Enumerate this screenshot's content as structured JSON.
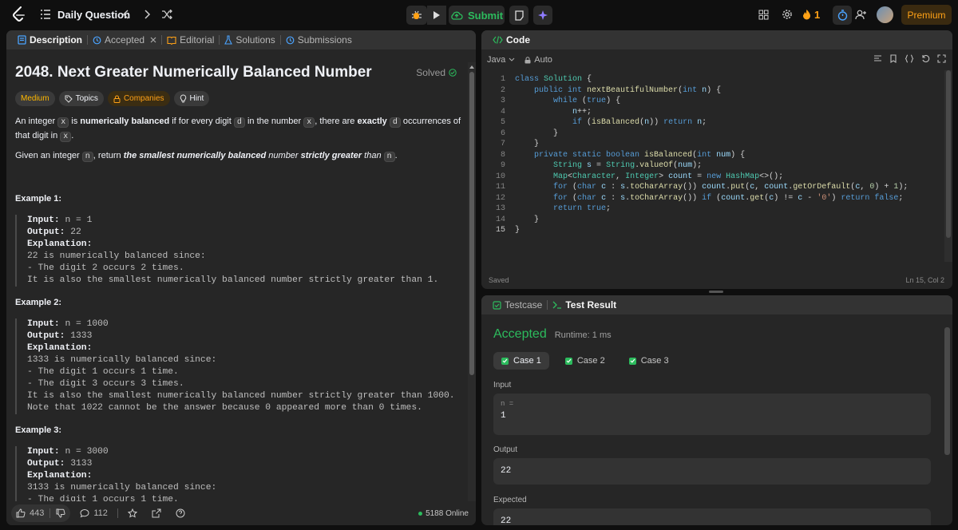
{
  "topbar": {
    "problem_list_label": "Daily Question",
    "submit_label": "Submit",
    "streak_count": "1",
    "premium_label": "Premium",
    "icons": {
      "logo": "leetcode-logo-icon",
      "list": "list-icon",
      "prev": "chevron-left-icon",
      "next": "chevron-right-icon",
      "shuffle": "shuffle-icon",
      "debug": "debug-icon",
      "run": "play-icon",
      "submit": "cloud-upload-icon",
      "notes": "note-icon",
      "ai": "sparkle-icon",
      "layout": "layout-grid-icon",
      "settings": "gear-icon",
      "streak": "flame-icon",
      "timer": "stopwatch-icon",
      "add_user": "add-user-icon"
    }
  },
  "description_panel": {
    "tabs": [
      {
        "label": "Description",
        "icon": "document-icon",
        "active": true
      },
      {
        "label": "Accepted",
        "icon": "history-icon",
        "active": false,
        "closable": true
      },
      {
        "label": "Editorial",
        "icon": "book-icon",
        "active": false
      },
      {
        "label": "Solutions",
        "icon": "flask-icon",
        "active": false
      },
      {
        "label": "Submissions",
        "icon": "history-icon",
        "active": false
      }
    ],
    "title": "2048. Next Greater Numerically Balanced Number",
    "status": "Solved",
    "chips": [
      "Medium",
      "Topics",
      "Companies",
      "Hint"
    ],
    "paragraph1": {
      "t1": "An integer ",
      "c1": "x",
      "t2": " is ",
      "b1": "numerically balanced",
      "t3": " if for every digit ",
      "c2": "d",
      "t4": " in the number ",
      "c3": "x",
      "t5": ", there are ",
      "b2": "exactly",
      "t6": " ",
      "c4": "d",
      "t7": " occurrences of that digit in ",
      "c5": "x",
      "t8": "."
    },
    "paragraph2": {
      "t1": "Given an integer ",
      "c1": "n",
      "t2": ", return ",
      "bi1": "the smallest numerically balanced",
      "i1": " number ",
      "bi2": "strictly greater",
      "i2": " than ",
      "c2": "n",
      "t3": "."
    },
    "examples": [
      {
        "heading": "Example 1:",
        "input_label": "Input:",
        "input": "n = 1",
        "output_label": "Output:",
        "output": "22",
        "explanation_label": "Explanation:",
        "lines": [
          "22 is numerically balanced since:",
          "- The digit 2 occurs 2 times.",
          "It is also the smallest numerically balanced number strictly greater than 1."
        ]
      },
      {
        "heading": "Example 2:",
        "input_label": "Input:",
        "input": "n = 1000",
        "output_label": "Output:",
        "output": "1333",
        "explanation_label": "Explanation:",
        "lines": [
          "1333 is numerically balanced since:",
          "- The digit 1 occurs 1 time.",
          "- The digit 3 occurs 3 times.",
          "It is also the smallest numerically balanced number strictly greater than 1000.",
          "Note that 1022 cannot be the answer because 0 appeared more than 0 times."
        ]
      },
      {
        "heading": "Example 3:",
        "input_label": "Input:",
        "input": "n = 3000",
        "output_label": "Output:",
        "output": "3133",
        "explanation_label": "Explanation:",
        "lines": [
          "3133 is numerically balanced since:",
          "- The digit 1 occurs 1 time."
        ]
      }
    ],
    "footer": {
      "likes": "443",
      "comments": "112",
      "online": "5188 Online"
    }
  },
  "code_panel": {
    "title": "Code",
    "language": "Java",
    "auto_label": "Auto",
    "status": "Saved",
    "cursor": "Ln 15, Col 2",
    "line_numbers": [
      "1",
      "2",
      "3",
      "4",
      "5",
      "6",
      "7",
      "8",
      "9",
      "10",
      "11",
      "12",
      "13",
      "14",
      "15"
    ]
  },
  "test_panel": {
    "tabs": [
      {
        "label": "Testcase",
        "active": false
      },
      {
        "label": "Test Result",
        "active": true
      }
    ],
    "result": "Accepted",
    "runtime": "Runtime: 1 ms",
    "cases": [
      "Case 1",
      "Case 2",
      "Case 3"
    ],
    "input_label": "Input",
    "input_var": "n =",
    "input_value": "1",
    "output_label": "Output",
    "output_value": "22",
    "expected_label": "Expected",
    "expected_value": "22"
  },
  "colors": {
    "accent_orange": "#ffa116",
    "accent_green": "#2cbb5d",
    "panel_bg": "#262626",
    "page_bg": "#0f0f0f"
  }
}
